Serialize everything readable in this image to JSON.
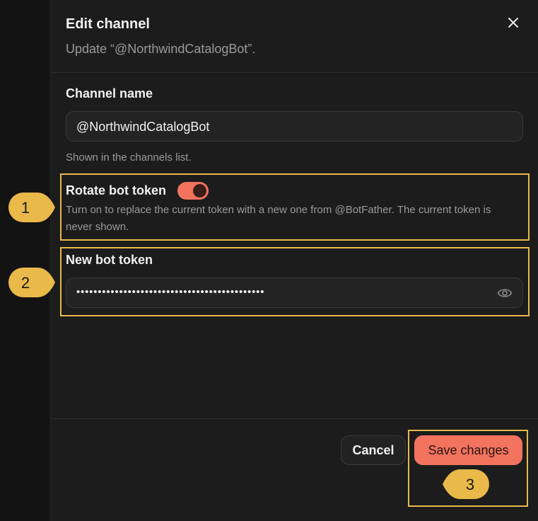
{
  "dialog": {
    "title": "Edit channel",
    "subtitle": "Update “@NorthwindCatalogBot”.",
    "close_icon": "close-icon"
  },
  "form": {
    "channel_name": {
      "label": "Channel name",
      "value": "@NorthwindCatalogBot",
      "hint": "Shown in the channels list."
    },
    "rotate_token": {
      "label": "Rotate bot token",
      "enabled": true,
      "hint": "Turn on to replace the current token with a new one from @BotFather. The current token is never shown."
    },
    "new_token": {
      "label": "New bot token",
      "masked_value": "••••••••••••••••••••••••••••••••••••••••••••",
      "toggle_visibility_icon": "eye-icon"
    }
  },
  "footer": {
    "cancel_label": "Cancel",
    "save_label": "Save changes"
  },
  "annotations": {
    "callouts": [
      "1",
      "2",
      "3"
    ],
    "highlight_color": "#e9b949"
  },
  "colors": {
    "accent": "#f2735e",
    "background": "#1c1c1c"
  }
}
